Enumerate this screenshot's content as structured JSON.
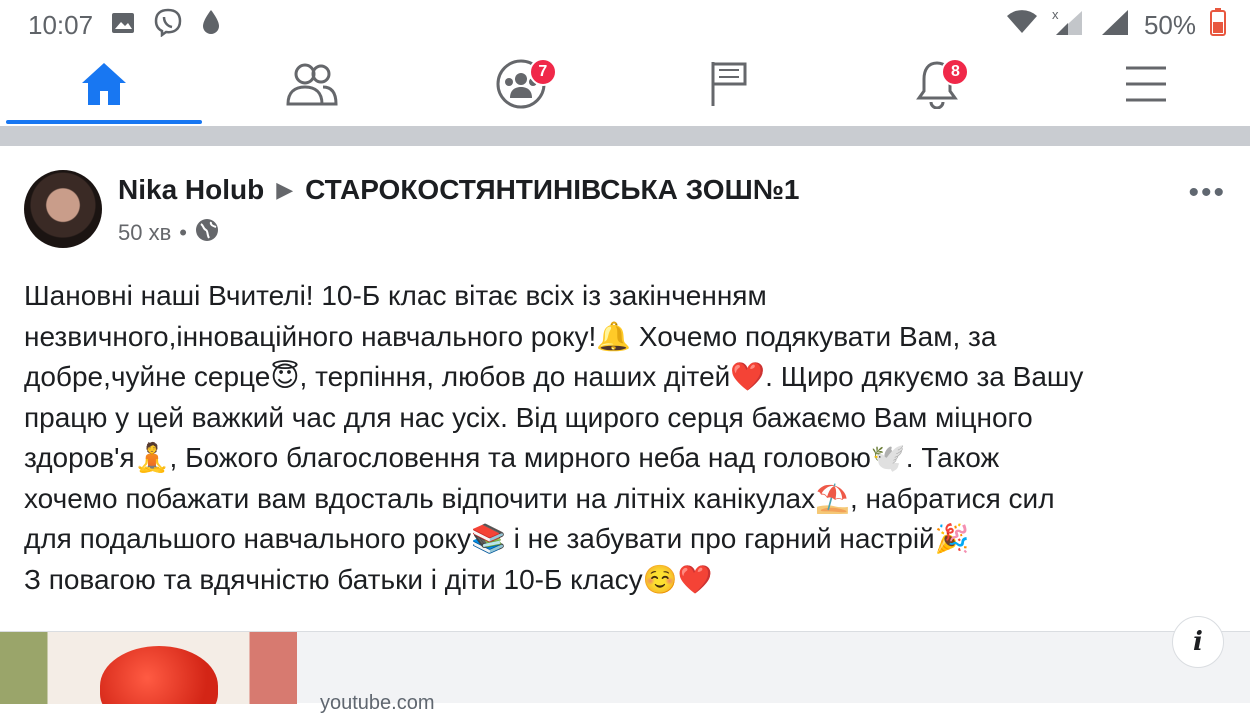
{
  "status_bar": {
    "time": "10:07",
    "battery": "50%",
    "icons": [
      "image-icon",
      "viber-icon",
      "drop-icon",
      "wifi-icon",
      "signal-x-icon",
      "signal-icon",
      "battery-icon"
    ]
  },
  "nav": {
    "tabs": [
      {
        "name": "home",
        "icon": "home-icon",
        "active": true
      },
      {
        "name": "friends",
        "icon": "friends-icon"
      },
      {
        "name": "groups",
        "icon": "groups-icon",
        "badge": "7"
      },
      {
        "name": "pages",
        "icon": "flag-icon"
      },
      {
        "name": "notifications",
        "icon": "bell-icon",
        "badge": "8"
      },
      {
        "name": "menu",
        "icon": "hamburger-icon"
      }
    ],
    "accent": "#1877f2",
    "badge_color": "#f02849"
  },
  "post": {
    "author": "Nika Holub",
    "arrow": "▶",
    "target": "СТАРОКОСТЯНТИНІВСЬКА ЗОШ№1",
    "time_ago": "50 хв",
    "separator": "•",
    "more": "•••",
    "body": "Шановні наші Вчителі! 10-Б клас вітає всіх із закінченням\nнезвичного,інноваційного навчального року!🔔 Хочемо подякувати Вам, за\nдобре,чуйне серце😇, терпіння, любов до наших дітей❤️. Щиро дякуємо за Вашу\nпрацю у цей важкий час для нас усіх. Від щирого серця бажаємо Вам міцного\nздоров'я🧘, Божого благословення та мирного неба над головою🕊️. Також\nхочемо побажати вам вдосталь відпочити на літніх канікулах⛱️, набратися сил\nдля подальшого навчального року📚 і не забувати про гарний настрій🎉\nЗ повагою та вдячністю батьки і діти 10-Б класу☺️❤️"
  },
  "link": {
    "domain": "youtube.com",
    "info": "i"
  }
}
